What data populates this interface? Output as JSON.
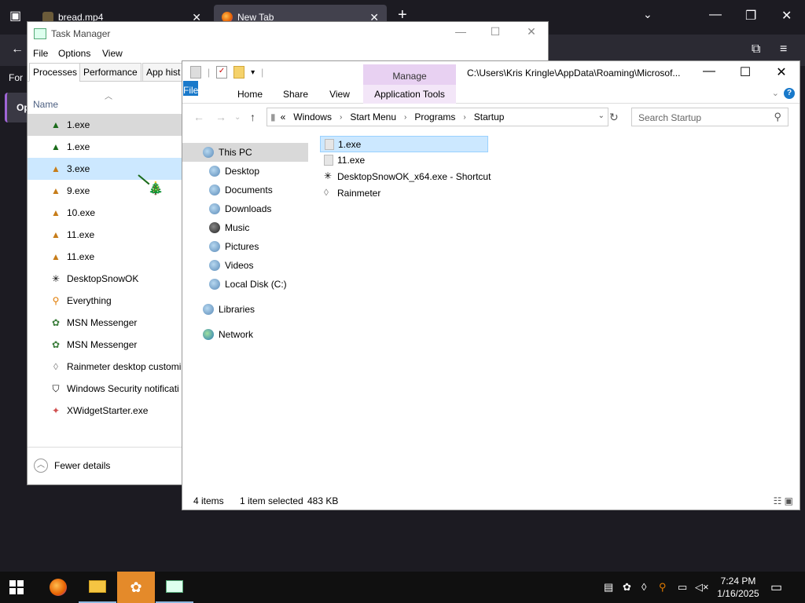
{
  "browser": {
    "tabs": [
      {
        "label": "bread.mp4"
      },
      {
        "label": "New Tab"
      }
    ],
    "for_label": "For",
    "op_label": "Op"
  },
  "task_manager": {
    "title": "Task Manager",
    "menu": [
      "File",
      "Options",
      "View"
    ],
    "tabs": [
      "Processes",
      "Performance",
      "App hist"
    ],
    "column_name": "Name",
    "processes": [
      {
        "name": "1.exe",
        "icon": "tree-icon"
      },
      {
        "name": "1.exe",
        "icon": "tree-icon"
      },
      {
        "name": "3.exe",
        "icon": "tree-icon"
      },
      {
        "name": "9.exe",
        "icon": "tree-icon"
      },
      {
        "name": "10.exe",
        "icon": "tree-icon"
      },
      {
        "name": "11.exe",
        "icon": "tree-icon"
      },
      {
        "name": "11.exe",
        "icon": "tree-icon"
      },
      {
        "name": "DesktopSnowOK",
        "icon": "snowflake-icon"
      },
      {
        "name": "Everything",
        "icon": "magnifier-icon"
      },
      {
        "name": "MSN Messenger",
        "icon": "msn-icon"
      },
      {
        "name": "MSN Messenger",
        "icon": "msn-icon"
      },
      {
        "name": "Rainmeter desktop customi",
        "icon": "droplet-icon"
      },
      {
        "name": "Windows Security notificati",
        "icon": "shield-icon"
      },
      {
        "name": "XWidgetStarter.exe",
        "icon": "xwidget-icon"
      }
    ],
    "fewer_details": "Fewer details"
  },
  "explorer": {
    "manage_label": "Manage",
    "title_path": "C:\\Users\\Kris Kringle\\AppData\\Roaming\\Microsof...",
    "ribbon_tabs": {
      "file": "File",
      "home": "Home",
      "share": "Share",
      "view": "View",
      "app_tools": "Application Tools"
    },
    "breadcrumb": [
      "«",
      "Windows",
      "Start Menu",
      "Programs",
      "Startup"
    ],
    "search_placeholder": "Search Startup",
    "nav_items": [
      {
        "label": "This PC",
        "indent": 0
      },
      {
        "label": "Desktop",
        "indent": 1
      },
      {
        "label": "Documents",
        "indent": 1
      },
      {
        "label": "Downloads",
        "indent": 1
      },
      {
        "label": "Music",
        "indent": 1
      },
      {
        "label": "Pictures",
        "indent": 1
      },
      {
        "label": "Videos",
        "indent": 1
      },
      {
        "label": "Local Disk (C:)",
        "indent": 1
      },
      {
        "label": "Libraries",
        "indent": 0
      },
      {
        "label": "Network",
        "indent": 0
      }
    ],
    "files": [
      {
        "name": "1.exe",
        "selected": true
      },
      {
        "name": "11.exe",
        "selected": false
      },
      {
        "name": "DesktopSnowOK_x64.exe - Shortcut",
        "selected": false
      },
      {
        "name": "Rainmeter",
        "selected": false
      }
    ],
    "status": {
      "items": "4 items",
      "selected": "1 item selected",
      "size": "483 KB"
    }
  },
  "file_list": {
    "items": [
      {
        "icon": "🎄"
      }
    ]
  },
  "taskbar": {
    "time": "7:24 PM",
    "date": "1/16/2025"
  }
}
